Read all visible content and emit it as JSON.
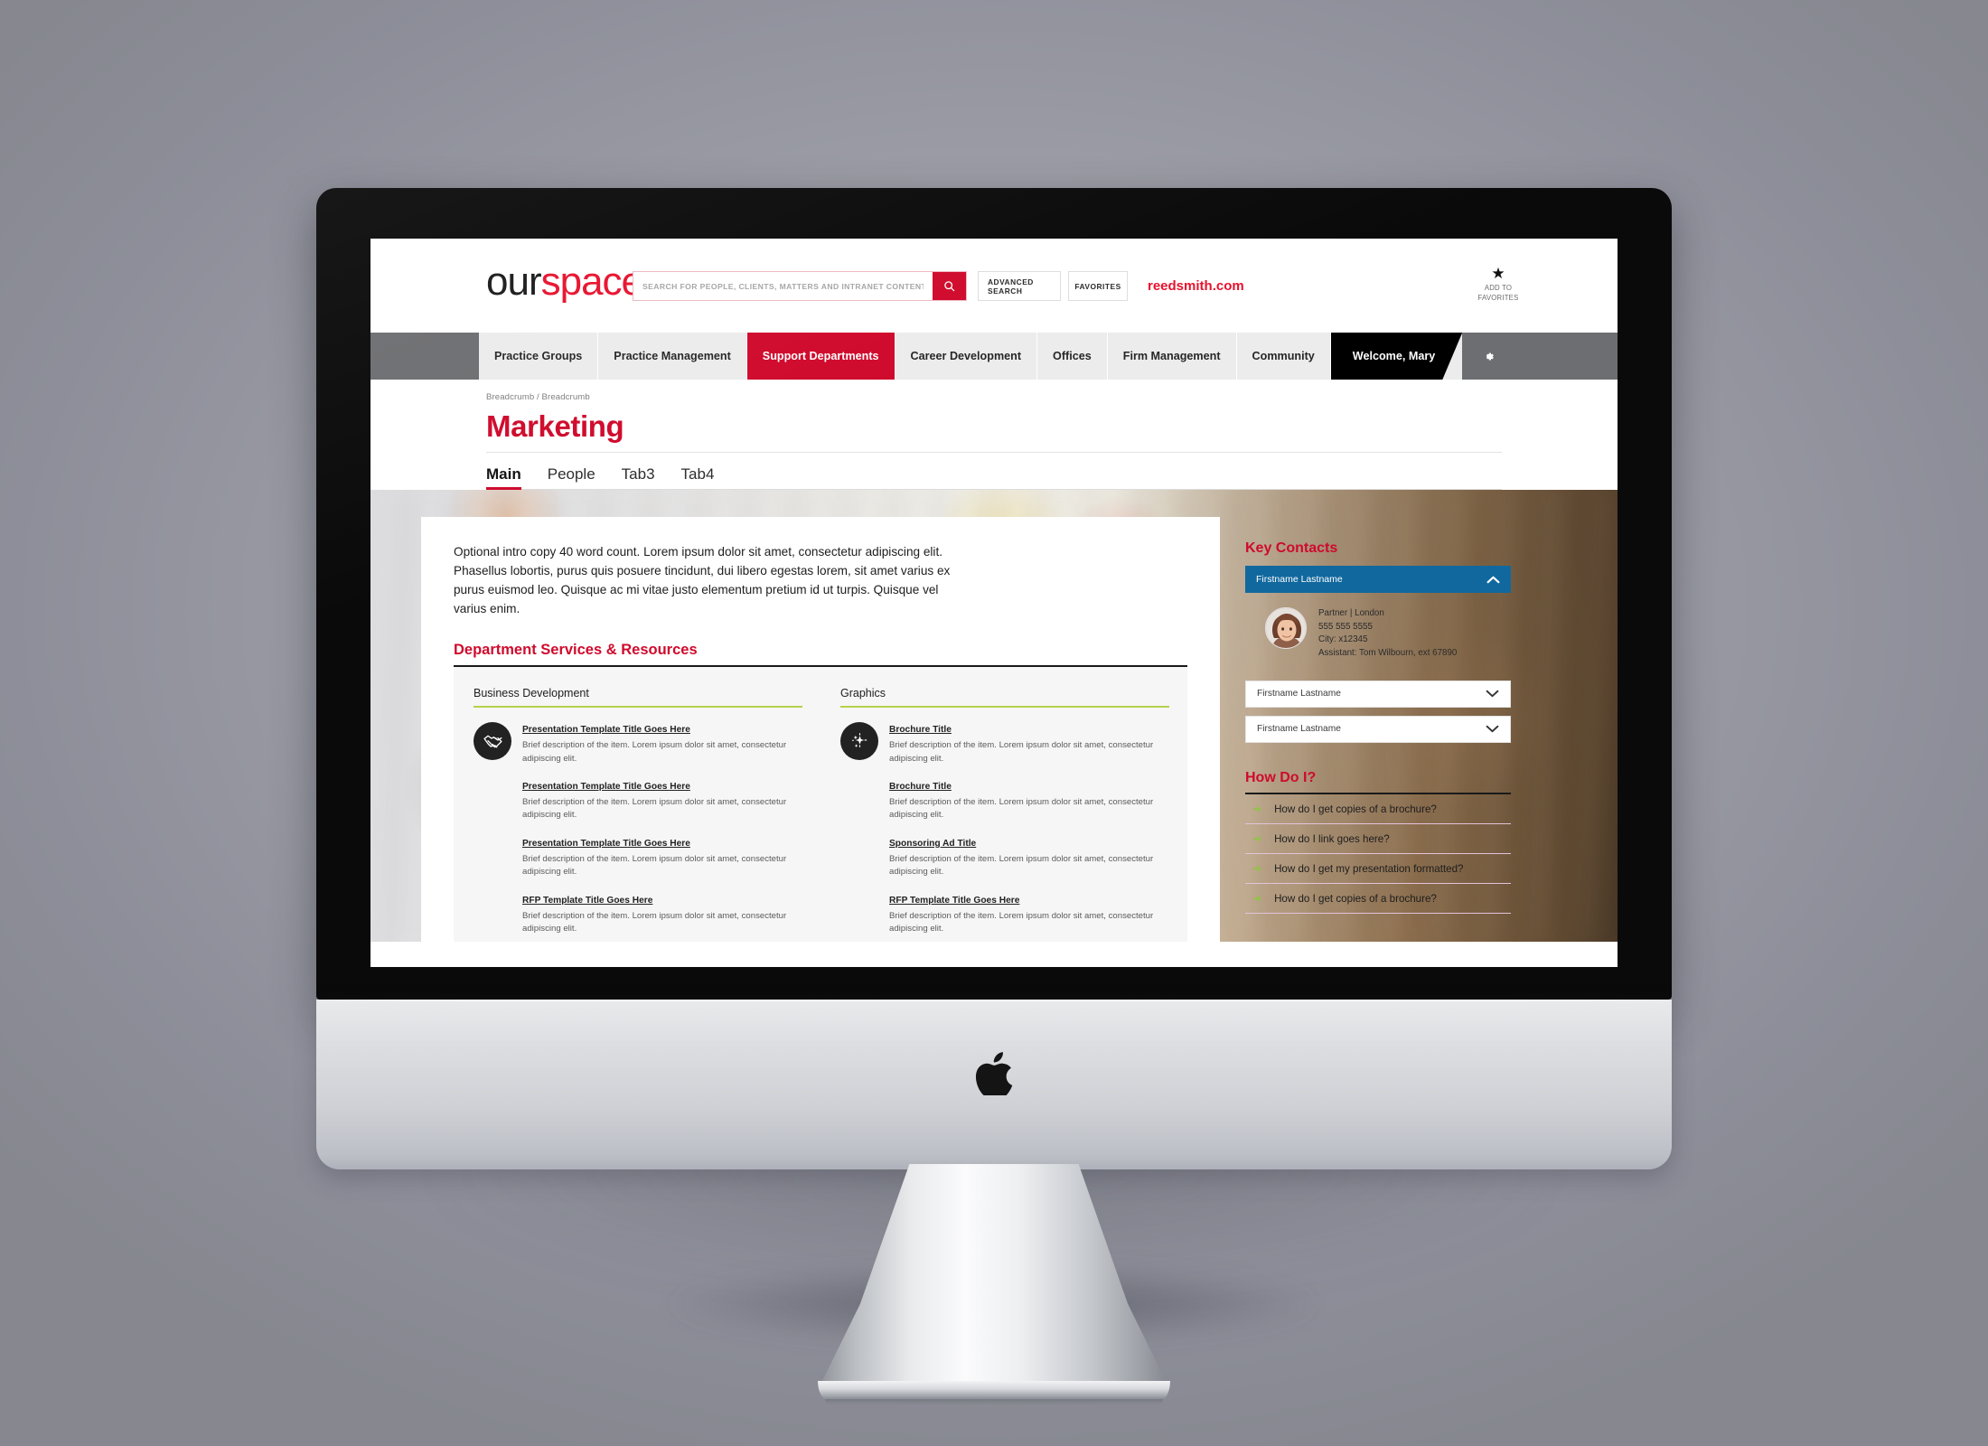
{
  "header": {
    "logo_our": "our",
    "logo_space": "space",
    "search_placeholder": "SEARCH FOR PEOPLE, CLIENTS, MATTERS AND INTRANET CONTENT.",
    "search_value": "",
    "search_icon": "search-icon",
    "advanced_search_label": "ADVANCED SEARCH",
    "favorites_label": "FAVORITES",
    "site_link": "reedsmith.com",
    "add_to_favorites": {
      "star": "★",
      "line1": "ADD TO",
      "line2": "FAVORITES"
    }
  },
  "nav": {
    "items": [
      {
        "label": "Practice Groups",
        "active": false
      },
      {
        "label": "Practice Management",
        "active": false
      },
      {
        "label": "Support Departments",
        "active": true
      },
      {
        "label": "Career Development",
        "active": false
      },
      {
        "label": "Offices",
        "active": false
      },
      {
        "label": "Firm Management",
        "active": false
      },
      {
        "label": "Community",
        "active": false
      }
    ],
    "user_label": "Welcome, Mary",
    "gear_icon": "gear-icon"
  },
  "page": {
    "breadcrumb": "Breadcrumb / Breadcrumb",
    "title": "Marketing",
    "tabs": [
      {
        "label": "Main",
        "active": true
      },
      {
        "label": "People",
        "active": false
      },
      {
        "label": "Tab3",
        "active": false
      },
      {
        "label": "Tab4",
        "active": false
      }
    ]
  },
  "main": {
    "intro": "Optional intro copy 40 word count. Lorem ipsum dolor sit amet, consectetur adipiscing elit. Phasellus lobortis, purus quis posuere tincidunt, dui libero egestas lorem, sit amet varius ex purus euismod leo. Quisque ac mi vitae justo elementum pretium id ut turpis. Quisque vel varius enim.",
    "section_title": "Department Services & Resources",
    "columns": [
      {
        "title": "Business Development",
        "icon": "handshake-icon",
        "items": [
          {
            "title": "Presentation Template Title Goes Here",
            "desc": "Brief description of the item. Lorem ipsum dolor sit amet, consectetur adipiscing elit."
          },
          {
            "title": "Presentation Template Title Goes Here",
            "desc": "Brief description of the item. Lorem ipsum dolor sit amet, consectetur adipiscing elit."
          },
          {
            "title": "Presentation Template Title Goes Here",
            "desc": "Brief description of the item. Lorem ipsum dolor sit amet, consectetur adipiscing elit."
          },
          {
            "title": "RFP Template Title Goes Here",
            "desc": "Brief description of the item. Lorem ipsum dolor sit amet, consectetur adipiscing elit."
          }
        ]
      },
      {
        "title": "Graphics",
        "icon": "sparkle-icon",
        "items": [
          {
            "title": "Brochure Title",
            "desc": "Brief description of the item. Lorem ipsum dolor sit amet, consectetur adipiscing elit."
          },
          {
            "title": "Brochure Title",
            "desc": "Brief description of the item. Lorem ipsum dolor sit amet, consectetur adipiscing elit."
          },
          {
            "title": "Sponsoring Ad Title",
            "desc": "Brief description of the item. Lorem ipsum dolor sit amet, consectetur adipiscing elit."
          },
          {
            "title": "RFP Template Title Goes Here",
            "desc": "Brief description of the item. Lorem ipsum dolor sit amet, consectetur adipiscing elit."
          }
        ]
      }
    ]
  },
  "rail": {
    "key_contacts_title": "Key Contacts",
    "expanded": {
      "name": "Firstname Lastname",
      "chevron": "chevron-up-icon",
      "role_location": "Partner  |  London",
      "phone": "555 555 5555",
      "city": "City: x12345",
      "assistant": "Assistant: Tom Wilbourn, ext 67890"
    },
    "collapsed": [
      {
        "name": "Firstname Lastname",
        "chevron": "chevron-down-icon"
      },
      {
        "name": "Firstname Lastname",
        "chevron": "chevron-down-icon"
      }
    ],
    "how_do_i_title": "How Do I?",
    "how_do_i": [
      "How do I get copies of a brochure?",
      "How do I link goes here?",
      "How do I get my presentation formatted?",
      "How do I get copies of a brochure?"
    ],
    "arrow_glyph": "➜"
  },
  "colors": {
    "brand_red": "#cf0a2c",
    "accent_red": "#e8112d",
    "accent_blue": "#11689e",
    "accent_green": "#b4d24a",
    "arrow_green": "#8cc63f",
    "nav_gray": "#6d6e71",
    "nav_bg": "#ececec"
  }
}
